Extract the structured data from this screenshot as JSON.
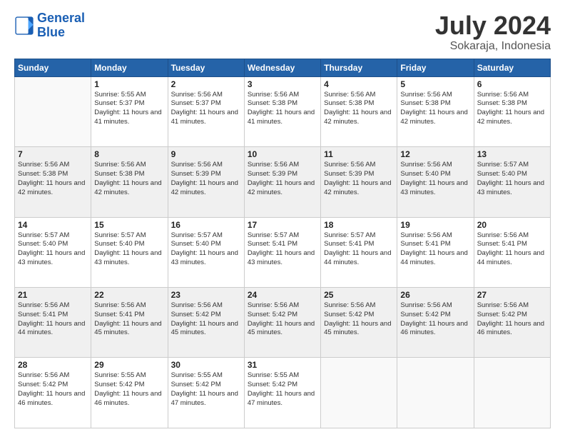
{
  "logo": {
    "line1": "General",
    "line2": "Blue"
  },
  "title": {
    "month_year": "July 2024",
    "location": "Sokaraja, Indonesia"
  },
  "weekdays": [
    "Sunday",
    "Monday",
    "Tuesday",
    "Wednesday",
    "Thursday",
    "Friday",
    "Saturday"
  ],
  "weeks": [
    [
      {
        "day": "",
        "sunrise": "",
        "sunset": "",
        "daylight": ""
      },
      {
        "day": "1",
        "sunrise": "5:55 AM",
        "sunset": "5:37 PM",
        "daylight": "11 hours and 41 minutes."
      },
      {
        "day": "2",
        "sunrise": "5:56 AM",
        "sunset": "5:37 PM",
        "daylight": "11 hours and 41 minutes."
      },
      {
        "day": "3",
        "sunrise": "5:56 AM",
        "sunset": "5:38 PM",
        "daylight": "11 hours and 41 minutes."
      },
      {
        "day": "4",
        "sunrise": "5:56 AM",
        "sunset": "5:38 PM",
        "daylight": "11 hours and 42 minutes."
      },
      {
        "day": "5",
        "sunrise": "5:56 AM",
        "sunset": "5:38 PM",
        "daylight": "11 hours and 42 minutes."
      },
      {
        "day": "6",
        "sunrise": "5:56 AM",
        "sunset": "5:38 PM",
        "daylight": "11 hours and 42 minutes."
      }
    ],
    [
      {
        "day": "7",
        "sunrise": "5:56 AM",
        "sunset": "5:38 PM",
        "daylight": "11 hours and 42 minutes."
      },
      {
        "day": "8",
        "sunrise": "5:56 AM",
        "sunset": "5:38 PM",
        "daylight": "11 hours and 42 minutes."
      },
      {
        "day": "9",
        "sunrise": "5:56 AM",
        "sunset": "5:39 PM",
        "daylight": "11 hours and 42 minutes."
      },
      {
        "day": "10",
        "sunrise": "5:56 AM",
        "sunset": "5:39 PM",
        "daylight": "11 hours and 42 minutes."
      },
      {
        "day": "11",
        "sunrise": "5:56 AM",
        "sunset": "5:39 PM",
        "daylight": "11 hours and 42 minutes."
      },
      {
        "day": "12",
        "sunrise": "5:56 AM",
        "sunset": "5:40 PM",
        "daylight": "11 hours and 43 minutes."
      },
      {
        "day": "13",
        "sunrise": "5:57 AM",
        "sunset": "5:40 PM",
        "daylight": "11 hours and 43 minutes."
      }
    ],
    [
      {
        "day": "14",
        "sunrise": "5:57 AM",
        "sunset": "5:40 PM",
        "daylight": "11 hours and 43 minutes."
      },
      {
        "day": "15",
        "sunrise": "5:57 AM",
        "sunset": "5:40 PM",
        "daylight": "11 hours and 43 minutes."
      },
      {
        "day": "16",
        "sunrise": "5:57 AM",
        "sunset": "5:40 PM",
        "daylight": "11 hours and 43 minutes."
      },
      {
        "day": "17",
        "sunrise": "5:57 AM",
        "sunset": "5:41 PM",
        "daylight": "11 hours and 43 minutes."
      },
      {
        "day": "18",
        "sunrise": "5:57 AM",
        "sunset": "5:41 PM",
        "daylight": "11 hours and 44 minutes."
      },
      {
        "day": "19",
        "sunrise": "5:56 AM",
        "sunset": "5:41 PM",
        "daylight": "11 hours and 44 minutes."
      },
      {
        "day": "20",
        "sunrise": "5:56 AM",
        "sunset": "5:41 PM",
        "daylight": "11 hours and 44 minutes."
      }
    ],
    [
      {
        "day": "21",
        "sunrise": "5:56 AM",
        "sunset": "5:41 PM",
        "daylight": "11 hours and 44 minutes."
      },
      {
        "day": "22",
        "sunrise": "5:56 AM",
        "sunset": "5:41 PM",
        "daylight": "11 hours and 45 minutes."
      },
      {
        "day": "23",
        "sunrise": "5:56 AM",
        "sunset": "5:42 PM",
        "daylight": "11 hours and 45 minutes."
      },
      {
        "day": "24",
        "sunrise": "5:56 AM",
        "sunset": "5:42 PM",
        "daylight": "11 hours and 45 minutes."
      },
      {
        "day": "25",
        "sunrise": "5:56 AM",
        "sunset": "5:42 PM",
        "daylight": "11 hours and 45 minutes."
      },
      {
        "day": "26",
        "sunrise": "5:56 AM",
        "sunset": "5:42 PM",
        "daylight": "11 hours and 46 minutes."
      },
      {
        "day": "27",
        "sunrise": "5:56 AM",
        "sunset": "5:42 PM",
        "daylight": "11 hours and 46 minutes."
      }
    ],
    [
      {
        "day": "28",
        "sunrise": "5:56 AM",
        "sunset": "5:42 PM",
        "daylight": "11 hours and 46 minutes."
      },
      {
        "day": "29",
        "sunrise": "5:55 AM",
        "sunset": "5:42 PM",
        "daylight": "11 hours and 46 minutes."
      },
      {
        "day": "30",
        "sunrise": "5:55 AM",
        "sunset": "5:42 PM",
        "daylight": "11 hours and 47 minutes."
      },
      {
        "day": "31",
        "sunrise": "5:55 AM",
        "sunset": "5:42 PM",
        "daylight": "11 hours and 47 minutes."
      },
      {
        "day": "",
        "sunrise": "",
        "sunset": "",
        "daylight": ""
      },
      {
        "day": "",
        "sunrise": "",
        "sunset": "",
        "daylight": ""
      },
      {
        "day": "",
        "sunrise": "",
        "sunset": "",
        "daylight": ""
      }
    ]
  ]
}
